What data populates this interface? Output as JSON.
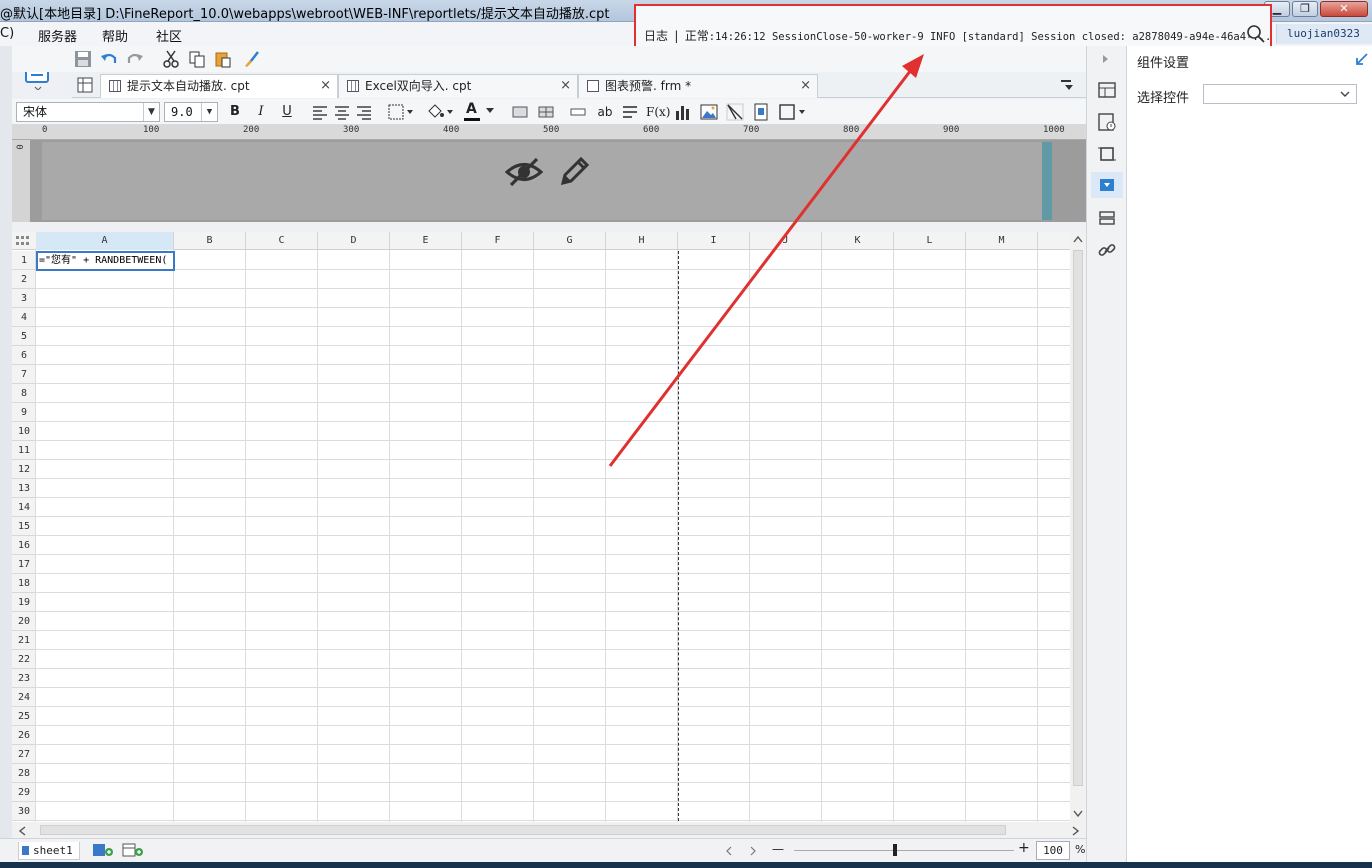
{
  "window": {
    "title": "@默认[本地目录]   D:\\FineReport_10.0\\webapps\\webroot\\WEB-INF\\reportlets/提示文本自动播放.cpt",
    "min": "▁",
    "max": "❐",
    "close": "✕"
  },
  "menu": {
    "items": [
      "C)",
      "服务器",
      "帮助",
      "社区"
    ]
  },
  "log": {
    "label": "日志",
    "separator": "|",
    "status": "正常",
    "message": ":14:26:12 SessionClose-50-worker-9 INFO [standard] Session closed: a2878049-a94e-46a4-..."
  },
  "user": {
    "name": "luojian0323"
  },
  "tabs": [
    {
      "label": "提示文本自动播放. cpt",
      "close": "×",
      "active": true
    },
    {
      "label": "Excel双向导入. cpt",
      "close": "×",
      "active": false
    },
    {
      "label": "图表预警. frm *",
      "close": "×",
      "active": false
    }
  ],
  "format": {
    "font_name": "宋体",
    "font_size": "9.0",
    "bold": "B",
    "italic": "I",
    "underline": "U",
    "text_style": "ab",
    "formula": "F(x)",
    "font_color_letter": "A"
  },
  "ruler": {
    "ticks": [
      "0",
      "100",
      "200",
      "300",
      "400",
      "500",
      "600",
      "700",
      "800",
      "900",
      "1000"
    ],
    "v_zero": "0"
  },
  "grid": {
    "columns": [
      "A",
      "B",
      "C",
      "D",
      "E",
      "F",
      "G",
      "H",
      "I",
      "J",
      "K",
      "L",
      "M"
    ],
    "rows": [
      "1",
      "2",
      "3",
      "4",
      "5",
      "6",
      "7",
      "8",
      "9",
      "10",
      "11",
      "12",
      "13",
      "14",
      "15",
      "16",
      "17",
      "18",
      "19",
      "20",
      "21",
      "22",
      "23",
      "24",
      "25",
      "26",
      "27",
      "28",
      "29",
      "30"
    ],
    "a1_value": "=\"您有\" + RANDBETWEEN("
  },
  "sheet": {
    "name": "sheet1"
  },
  "zoom": {
    "minus": "—",
    "plus": "+",
    "value": "100",
    "unit": "%"
  },
  "right_panel": {
    "title": "组件设置",
    "select_label": "选择控件",
    "select_value": ""
  },
  "colors": {
    "accent": "#3a78c8",
    "annotation": "#e03030"
  }
}
